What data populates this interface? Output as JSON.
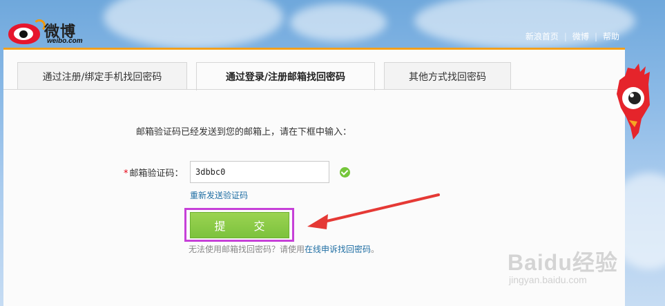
{
  "header": {
    "logo_text": "微博",
    "logo_sub": "weibo.com",
    "links": [
      {
        "label": "新浪首页"
      },
      {
        "label": "微博"
      },
      {
        "label": "帮助"
      }
    ],
    "separator": "|"
  },
  "tabs": [
    {
      "label": "通过注册/绑定手机找回密码",
      "active": false
    },
    {
      "label": "通过登录/注册邮箱找回密码",
      "active": true
    },
    {
      "label": "其他方式找回密码",
      "active": false
    }
  ],
  "form": {
    "hint": "邮箱验证码已经发送到您的邮箱上，请在下框中输入：",
    "required_mark": "*",
    "code_label": "邮箱验证码：",
    "code_value": "3dbbc0",
    "resend_label": "重新发送验证码",
    "submit_label": "提 交",
    "footer_prefix": "无法使用邮箱找回密码？请使用",
    "footer_link": "在线申诉找回密码",
    "footer_suffix": "。"
  },
  "watermark": {
    "text": "Baidu经验",
    "url": "jingyan.baidu.com"
  },
  "colors": {
    "accent_orange": "#f3a01c",
    "submit_green": "#7cc23d",
    "highlight_magenta": "#c640d8",
    "arrow_red": "#e53935",
    "link_blue": "#1f6ea3"
  }
}
